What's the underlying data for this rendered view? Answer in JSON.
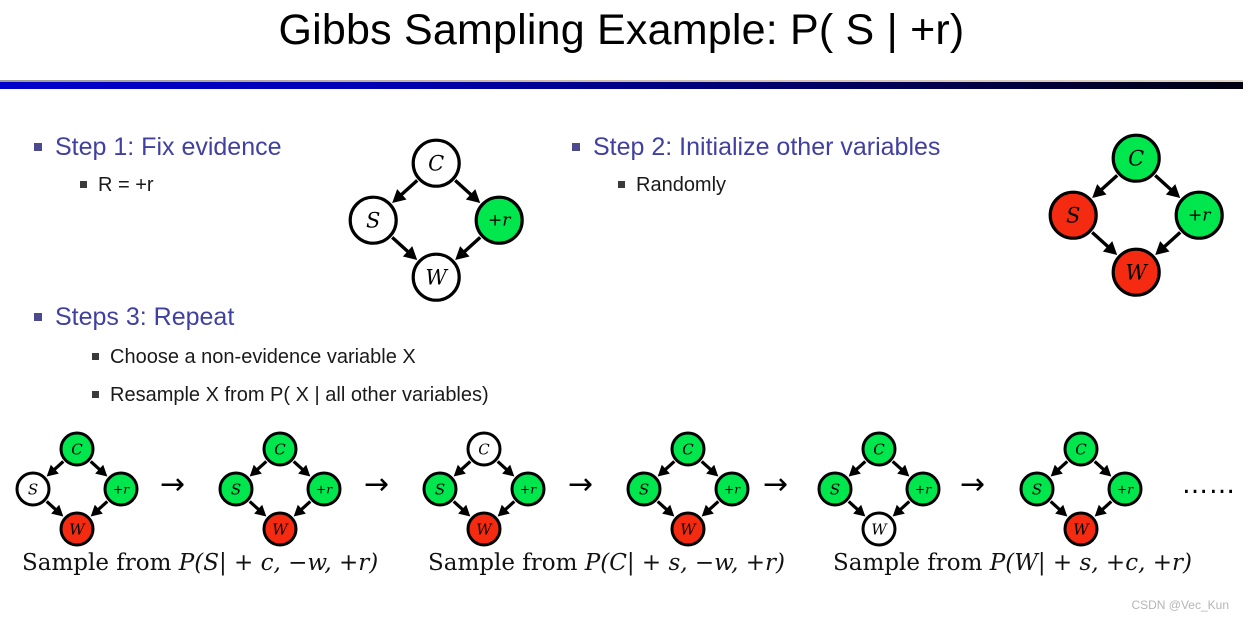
{
  "slide": {
    "title": "Gibbs Sampling Example: P( S | +r)",
    "watermark": "CSDN @Vec_Kun",
    "accent_color": "#4040a0",
    "rule_color": "#0000cc",
    "node_green": "#00e64d",
    "node_red": "#f42b10",
    "node_white": "#ffffff"
  },
  "steps": [
    {
      "id": "step1",
      "heading": "Step 1: Fix evidence",
      "sub": [
        "R = +r"
      ]
    },
    {
      "id": "step2",
      "heading": "Step 2: Initialize other variables",
      "sub": [
        "Randomly"
      ]
    },
    {
      "id": "step3",
      "heading": "Steps 3: Repeat",
      "sub": [
        "Choose a non-evidence variable X",
        "Resample X from P( X | all other variables)"
      ]
    }
  ],
  "networks": {
    "step1_net": {
      "label": "bayes-net-step1",
      "nodes": [
        {
          "id": "C",
          "text": "C",
          "fill": "#ffffff"
        },
        {
          "id": "S",
          "text": "S",
          "fill": "#ffffff"
        },
        {
          "id": "R",
          "text": "+r",
          "fill": "#00e64d"
        },
        {
          "id": "W",
          "text": "W",
          "fill": "#ffffff"
        }
      ],
      "edges": [
        "C->S",
        "C->R",
        "S->W",
        "R->W"
      ]
    },
    "step2_net": {
      "label": "bayes-net-step2",
      "nodes": [
        {
          "id": "C",
          "text": "C",
          "fill": "#00e64d"
        },
        {
          "id": "S",
          "text": "S",
          "fill": "#f42b10"
        },
        {
          "id": "R",
          "text": "+r",
          "fill": "#00e64d"
        },
        {
          "id": "W",
          "text": "W",
          "fill": "#f42b10"
        }
      ],
      "edges": [
        "C->S",
        "C->R",
        "S->W",
        "R->W"
      ]
    },
    "chain": [
      {
        "label": "bayes-net-chain-1",
        "nodes": [
          {
            "id": "C",
            "text": "C",
            "fill": "#00e64d"
          },
          {
            "id": "S",
            "text": "S",
            "fill": "#ffffff"
          },
          {
            "id": "R",
            "text": "+r",
            "fill": "#00e64d"
          },
          {
            "id": "W",
            "text": "W",
            "fill": "#f42b10"
          }
        ]
      },
      {
        "label": "bayes-net-chain-2",
        "nodes": [
          {
            "id": "C",
            "text": "C",
            "fill": "#00e64d"
          },
          {
            "id": "S",
            "text": "S",
            "fill": "#00e64d"
          },
          {
            "id": "R",
            "text": "+r",
            "fill": "#00e64d"
          },
          {
            "id": "W",
            "text": "W",
            "fill": "#f42b10"
          }
        ]
      },
      {
        "label": "bayes-net-chain-3",
        "nodes": [
          {
            "id": "C",
            "text": "C",
            "fill": "#ffffff"
          },
          {
            "id": "S",
            "text": "S",
            "fill": "#00e64d"
          },
          {
            "id": "R",
            "text": "+r",
            "fill": "#00e64d"
          },
          {
            "id": "W",
            "text": "W",
            "fill": "#f42b10"
          }
        ]
      },
      {
        "label": "bayes-net-chain-4",
        "nodes": [
          {
            "id": "C",
            "text": "C",
            "fill": "#00e64d"
          },
          {
            "id": "S",
            "text": "S",
            "fill": "#00e64d"
          },
          {
            "id": "R",
            "text": "+r",
            "fill": "#00e64d"
          },
          {
            "id": "W",
            "text": "W",
            "fill": "#f42b10"
          }
        ]
      },
      {
        "label": "bayes-net-chain-5",
        "nodes": [
          {
            "id": "C",
            "text": "C",
            "fill": "#00e64d"
          },
          {
            "id": "S",
            "text": "S",
            "fill": "#00e64d"
          },
          {
            "id": "R",
            "text": "+r",
            "fill": "#00e64d"
          },
          {
            "id": "W",
            "text": "W",
            "fill": "#ffffff"
          }
        ]
      },
      {
        "label": "bayes-net-chain-6",
        "nodes": [
          {
            "id": "C",
            "text": "C",
            "fill": "#00e64d"
          },
          {
            "id": "S",
            "text": "S",
            "fill": "#00e64d"
          },
          {
            "id": "R",
            "text": "+r",
            "fill": "#00e64d"
          },
          {
            "id": "W",
            "text": "W",
            "fill": "#f42b10"
          }
        ]
      }
    ],
    "chain_arrow": "→",
    "chain_ellipsis": "……"
  },
  "captions": [
    {
      "prefix": "Sample from ",
      "formula": "P(S| + c, −w, +r)"
    },
    {
      "prefix": "Sample from ",
      "formula": "P(C| + s, −w, +r)"
    },
    {
      "prefix": "Sample from ",
      "formula": "P(W| + s, +c, +r)"
    }
  ]
}
